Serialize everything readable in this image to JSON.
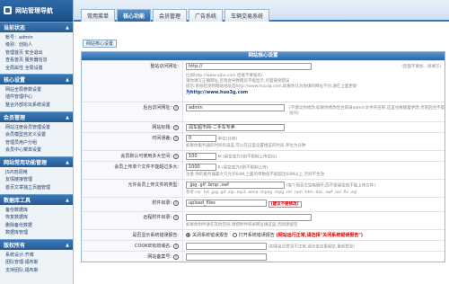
{
  "sidebar": {
    "title": "网站管理导航",
    "sections": [
      {
        "title": "当前状态",
        "lines": [
          "帐号：admin",
          "级别：创始人",
          "管理首页 安全退出",
          "查看首页 服务器信息",
          "全局属性 全局设置"
        ]
      },
      {
        "title": "核心设置",
        "lines": [
          "网站全局参数设置",
          "插件管理中心",
          "整合外部论坛系统设置"
        ]
      },
      {
        "title": "会员管理",
        "lines": [
          "网站注册会员管理设置",
          "会员模型自定义设置",
          "管理员用户分组",
          "会员中心菜单设置"
        ]
      },
      {
        "title": "网站常用功能管理",
        "lines": [
          "JS内容调用",
          "友情链接管理",
          "首页文章独立页面管理"
        ]
      },
      {
        "title": "数据库工具",
        "lines": [
          "备份数据库",
          "恢复数据库",
          "删除备份数据",
          "数据库管理"
        ]
      },
      {
        "title": "版权所有",
        "lines": [
          "系统设计:齐博",
          "团队管理:福布斯",
          "支持团队:福布斯"
        ]
      }
    ]
  },
  "tabs": [
    {
      "label": "常用菜单",
      "active": false
    },
    {
      "label": "核心功能",
      "active": true
    },
    {
      "label": "会员管理",
      "active": false
    },
    {
      "label": "广告系统",
      "active": false
    },
    {
      "label": "车辆交易系统",
      "active": false
    }
  ],
  "breadcrumb": "网站核心设置",
  "form": {
    "header": "网站核心设置",
    "rows": [
      {
        "label": "整站访问网址:",
        "value": "http://",
        "note": "(后面不要加...请填写)",
        "lines": [
          "比如http://www.qibo.com 结尾不要留有/",
          "请你填写正确网址,否则会导致网页不能显示,页面链接错误",
          "提示:系统检测到网站地址是http://www.huo3g.com,如果你认为你填的网址不对,请在上面更新",
          "为http://www.huo3g.com"
        ]
      },
      {
        "label": "后台访问网址:",
        "value": "admin",
        "note": "(不建议你修改,如果你修改后台目录admin文件夹名称,这里也要跟着更改,否则后台不能访问)"
      },
      {
        "label": "网站标题:",
        "value": "润车超市网-二手车专卖"
      },
      {
        "label": "时间误差:",
        "value": "0",
        "unit": "单位(分钟)",
        "note": "如果你服务器的时间有误差,可以在这里设置相差的时间,单位为分钟"
      },
      {
        "label": "会员默认可使用多大空间:",
        "value": "100",
        "unit": "M (留空或为0则不限制上传空间)"
      },
      {
        "label": "会员上传单个文件不能超过多大:",
        "value": "1000",
        "unit": "K (留空或为0则不限制上传)",
        "note": "注意:你的服务器最大只允许64M,上面的单数值不能超出64M以上,否则不生效"
      },
      {
        "label": "允许会员上传文件的类型:",
        "value": ".jpg .gif .bmp .swf",
        "note": "(每个用英文空格隔开,而不要留空则不能上传文件)",
        "extra": "参考:rar .txt .jpg .gif .zip .mp3 .wma .mpeg .mpg .rm .ram .htm .doc .swf .avi .flv .sql"
      },
      {
        "label": "附件目录:",
        "value": "upload_files",
        "badge": "(建议不要修改)"
      },
      {
        "label": "远程附件目录:",
        "value": "",
        "note": "如果你附件放在其他空间,请把附件目录网址填这里,否则请留空"
      },
      {
        "label": "是否显示系统错误报告:",
        "options": [
          "关闭系统错误报告",
          "打开系统错误报告"
        ],
        "selected": 0,
        "note": "(网站运行正常,请选择\"关闭系统错误报告\")"
      },
      {
        "label": "COOKIE有效域名:",
        "value": "",
        "note": "(如果会员登录不正常,请点击这里留空,重新登录)"
      },
      {
        "label": "网站备案号:",
        "value": ""
      }
    ]
  }
}
